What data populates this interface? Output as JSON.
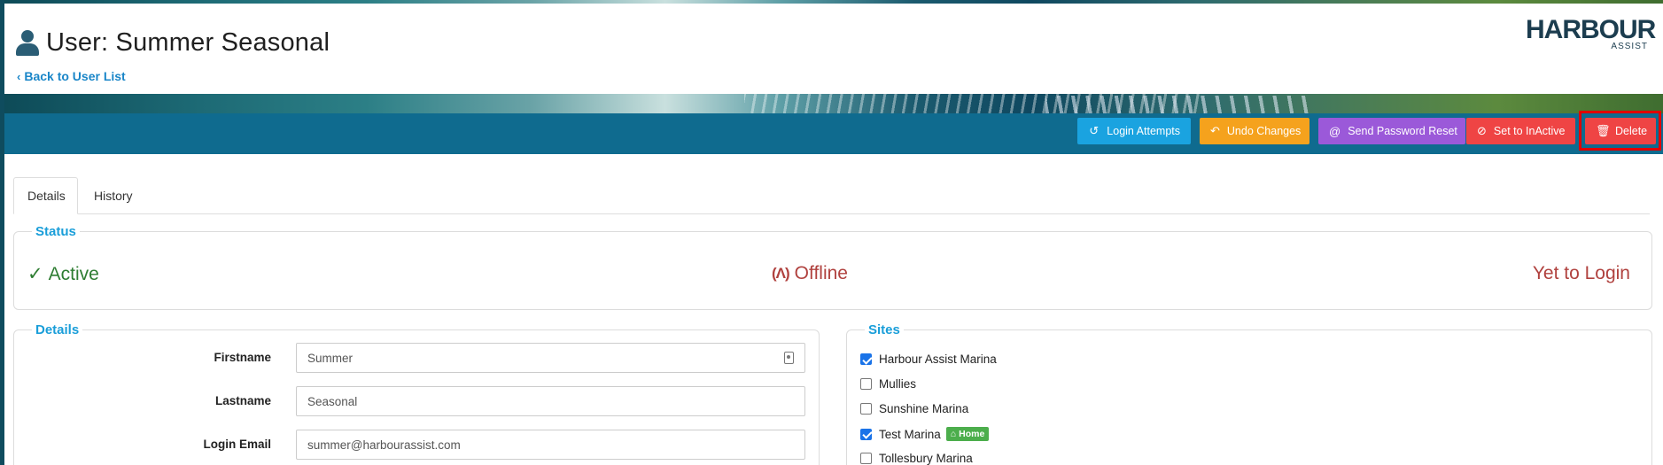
{
  "header": {
    "title": "User: Summer Seasonal",
    "back_link": "Back to User List",
    "logo_main": "HARBOUR",
    "logo_sub": "ASSIST"
  },
  "toolbar": {
    "login_attempts": "Login Attempts",
    "undo_changes": "Undo Changes",
    "send_password_reset": "Send Password Reset",
    "set_inactive": "Set to InActive",
    "delete": "Delete"
  },
  "tabs": [
    {
      "label": "Details",
      "active": true
    },
    {
      "label": "History",
      "active": false
    }
  ],
  "status": {
    "legend": "Status",
    "active": "Active",
    "connection": "Offline",
    "login": "Yet to Login"
  },
  "details": {
    "legend": "Details",
    "fields": [
      {
        "label": "Firstname",
        "value": "Summer"
      },
      {
        "label": "Lastname",
        "value": "Seasonal"
      },
      {
        "label": "Login Email",
        "value": "summer@harbourassist.com"
      }
    ]
  },
  "sites": {
    "legend": "Sites",
    "items": [
      {
        "label": "Harbour Assist Marina",
        "checked": true
      },
      {
        "label": "Mullies",
        "checked": false
      },
      {
        "label": "Sunshine Marina",
        "checked": false
      },
      {
        "label": "Test Marina",
        "checked": true,
        "badge": "Home"
      },
      {
        "label": "Tollesbury Marina",
        "checked": false
      }
    ]
  },
  "colors": {
    "toolbar": "#0f6b8f",
    "accent": "#1a9ed9",
    "active_green": "#2e7d32",
    "warning_red": "#b0413e",
    "delete_highlight": "#e00000"
  }
}
